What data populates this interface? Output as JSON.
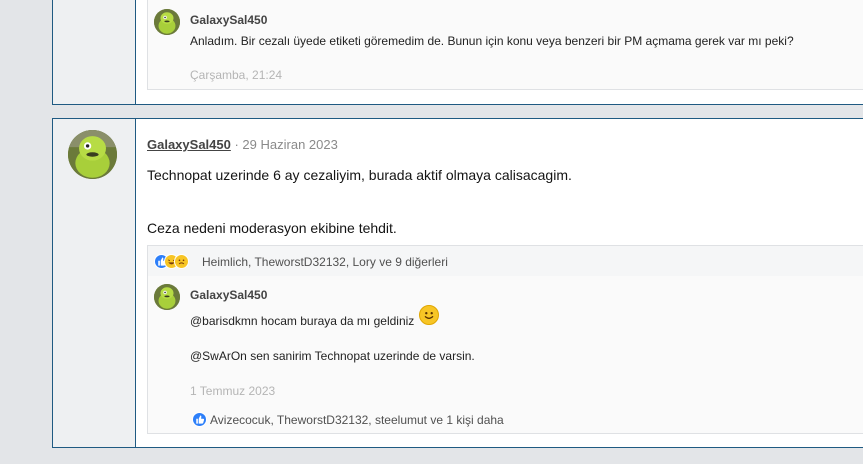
{
  "post_top": {
    "comment": {
      "author": "GalaxySal450",
      "text": "Anladım. Bir cezalı üyede etiketi göremedim de. Bunun için konu veya benzeri bir PM açmama gerek var mı peki?",
      "time": "Çarşamba, 21:24"
    }
  },
  "post_main": {
    "author": "GalaxySal450",
    "date": "· 29 Haziran 2023",
    "body_line1": "Technopat uzerinde 6 ay cezaliyim, burada aktif olmaya calisacagim.",
    "body_line2": "Ceza nedeni moderasyon ekibine tehdit.",
    "reactions_text": "Heimlich, TheworstD32132, Lory ve 9 diğerleri",
    "reaction_icons": [
      "like-icon",
      "laugh-icon",
      "sad-icon"
    ],
    "comment": {
      "author": "GalaxySal450",
      "line1": "@barisdkmn hocam buraya da mı geldiniz",
      "line2": "@SwArOn sen sanirim Technopat uzerinde de varsin.",
      "time": "1 Temmuz 2023",
      "reactions_text": "Avizecocuk, TheworstD32132, steelumut ve 1 kişi daha",
      "reaction_icons": [
        "like-icon"
      ]
    }
  },
  "colors": {
    "border_accent": "#1f5a82",
    "like_blue": "#2d7ff9",
    "smile_yellow": "#f7c525"
  }
}
